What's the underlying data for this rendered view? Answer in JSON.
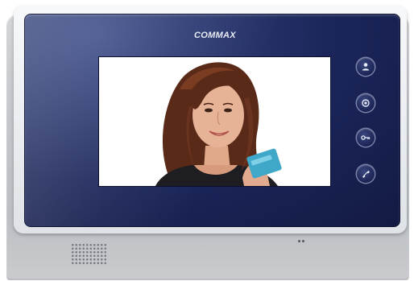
{
  "device": {
    "brand": "COMMAX",
    "color_panel": "#1b2559",
    "color_housing": "#c3c6ca"
  },
  "screen": {
    "content": "video-feed-visitor"
  },
  "buttons": [
    {
      "icon": "person-icon"
    },
    {
      "icon": "monitor-icon"
    },
    {
      "icon": "key-icon"
    },
    {
      "icon": "handset-icon"
    }
  ]
}
